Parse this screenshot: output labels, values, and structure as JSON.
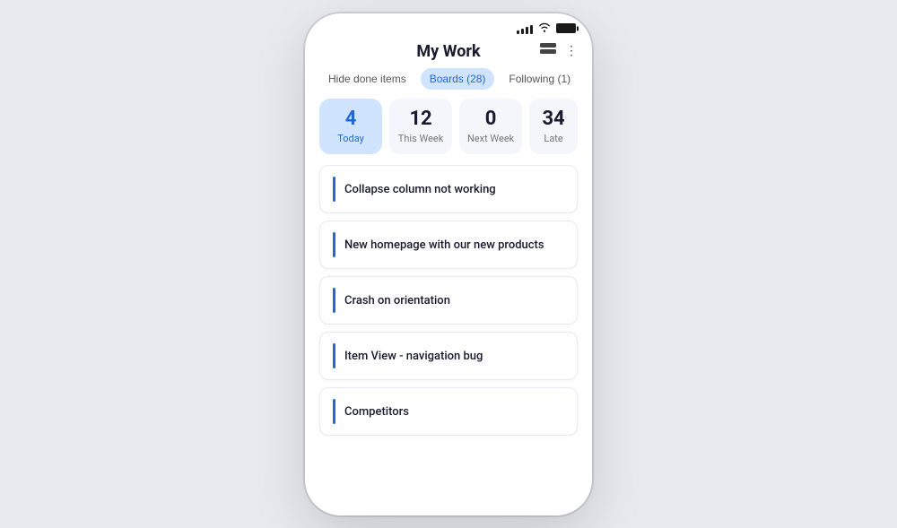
{
  "header": {
    "title": "My Work",
    "layout_icon": "⊟",
    "more_icon": "⋮"
  },
  "status_bar": {
    "battery": "full"
  },
  "tabs": [
    {
      "label": "Hide done items",
      "active": false
    },
    {
      "label": "Boards (28)",
      "active": true
    },
    {
      "label": "Following (1)",
      "active": false
    }
  ],
  "stats": [
    {
      "number": "4",
      "label": "Today",
      "active": true
    },
    {
      "number": "12",
      "label": "This Week",
      "active": false
    },
    {
      "number": "0",
      "label": "Next Week",
      "active": false
    },
    {
      "number": "34",
      "label": "Late",
      "active": false,
      "partial": true
    }
  ],
  "items": [
    {
      "text": "Collapse column not working"
    },
    {
      "text": "New homepage with our new products"
    },
    {
      "text": "Crash on orientation"
    },
    {
      "text": "Item View - navigation bug"
    },
    {
      "text": "Competitors"
    }
  ]
}
